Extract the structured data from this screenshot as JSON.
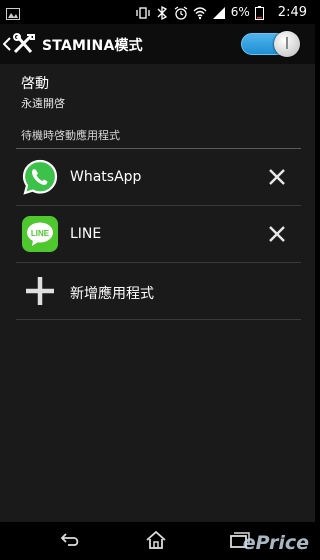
{
  "status_bar": {
    "battery_text": "6%",
    "time": "2:49"
  },
  "header": {
    "title": "STAMINA模式",
    "toggle_state": "on"
  },
  "setting": {
    "title": "啓動",
    "subtitle": "永遠開啓"
  },
  "section": {
    "header": "待機時啓動應用程式"
  },
  "apps": [
    {
      "name": "WhatsApp",
      "icon": "whatsapp-icon"
    },
    {
      "name": "LINE",
      "icon": "line-icon",
      "icon_text": "LINE"
    }
  ],
  "add_app": {
    "label": "新增應用程式",
    "icon": "plus-icon"
  },
  "watermark": "ePrice",
  "colors": {
    "accent": "#33a3e5",
    "whatsapp": "#3cc24a",
    "line": "#4fc72f"
  }
}
